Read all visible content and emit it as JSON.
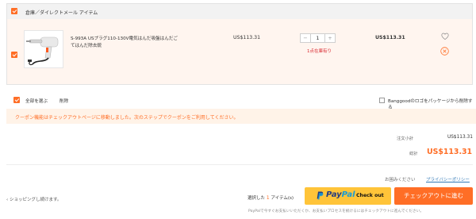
{
  "group": {
    "title": "倉庫／ダイレクトメール アイテム"
  },
  "item": {
    "name": "S-993A USプラグ110-130V電気はんだ吸盤はんだごてはんだ除去銃",
    "unit_price": "US$113.31",
    "quantity": "1",
    "minus": "−",
    "plus": "+",
    "stock_note": "1点在庫有り",
    "subtotal": "US$113.31",
    "icons": [
      "heart-icon",
      "remove-icon",
      "checkbox-icon",
      "product-image"
    ]
  },
  "select_bar": {
    "select_all": "全部を選ぶ",
    "delete": "削除",
    "banggood_logo": "Banggoodのロゴをパッケージから削除する"
  },
  "coupon_notice": "クーポン機能はチェックアウトページに移動しました。次のステップでクーポンをご利用してください。",
  "summary": {
    "order_subtotal_label": "注文小計",
    "order_subtotal_value": "US$113.31",
    "total_label": "総計",
    "total_value": "US$113.31"
  },
  "help": {
    "question": "お困みください",
    "policy_link": "プライバシーポリシー"
  },
  "footer": {
    "continue_shopping": "ショッピングし続けます。",
    "selected_prefix": "選択した",
    "selected_count": "1",
    "selected_suffix": "アイテム(s)",
    "paypal_pay": "Pay",
    "paypal_pal": "Pal",
    "paypal_checkout": "Check out",
    "checkout": "チェックアウトに進む",
    "footnote": "PayPalで今すぐお支払いいただくか、お支払いプロセスを続けるにはチェックアウトに進んでください。"
  },
  "colors": {
    "accent": "#ff6e26",
    "paypal_yellow": "#ffc439",
    "paypal_dark_blue": "#253b80",
    "paypal_light_blue": "#179bd7",
    "stock_red": "#d9272e",
    "link_blue": "#337ab7"
  }
}
